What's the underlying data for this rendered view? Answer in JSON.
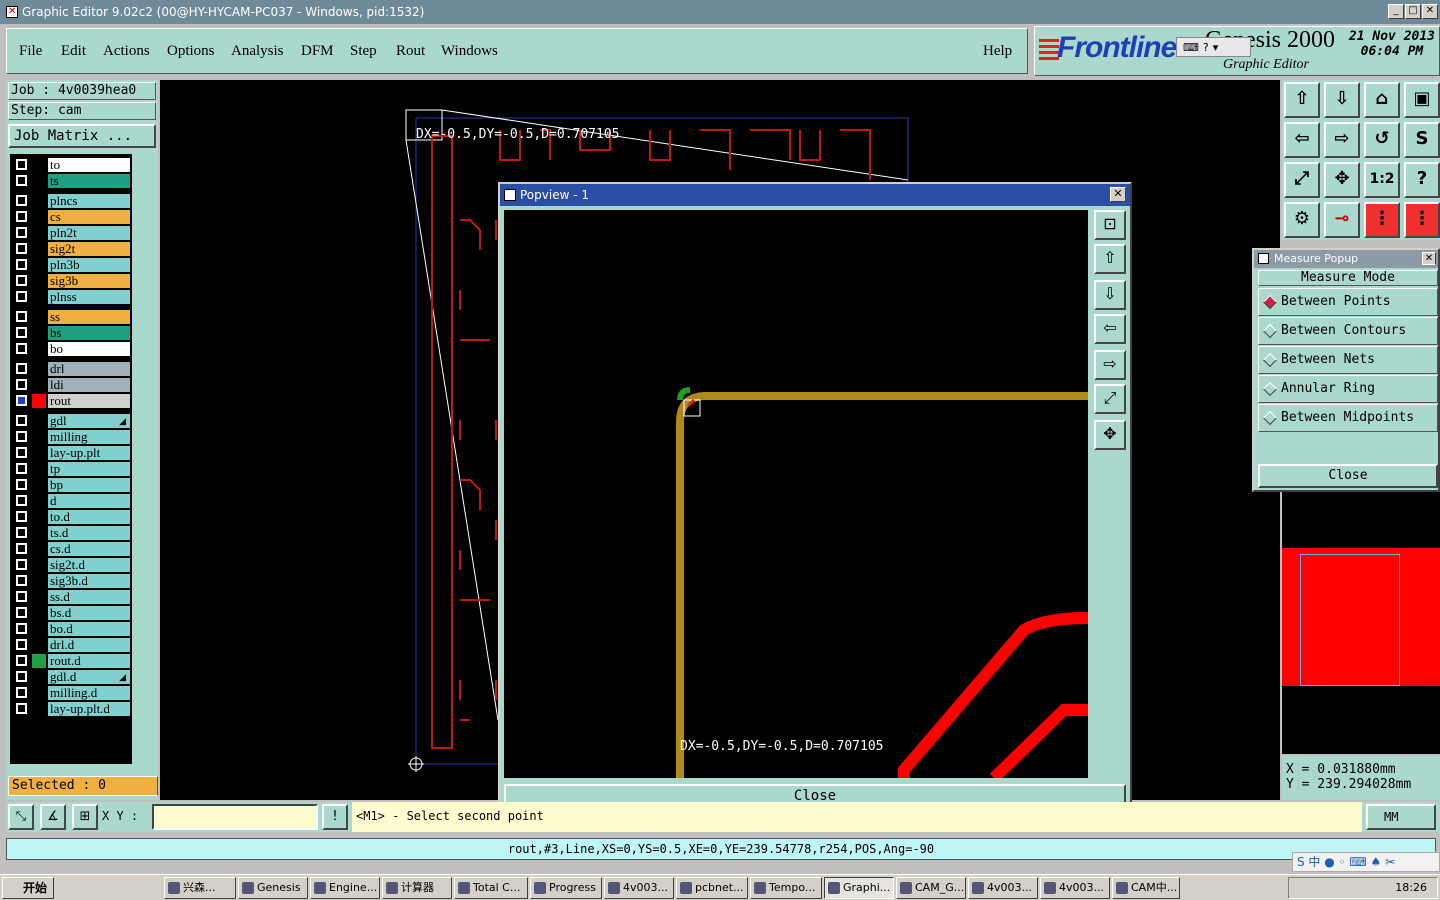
{
  "window": {
    "title": "Graphic Editor 9.02c2 (00@HY-HYCAM-PC037 - Windows, pid:1532)",
    "min": "_",
    "max": "□",
    "close": "✕"
  },
  "menu": {
    "items": [
      "File",
      "Edit",
      "Actions",
      "Options",
      "Analysis",
      "DFM",
      "Step",
      "Rout",
      "Windows"
    ],
    "help": "Help"
  },
  "logo": {
    "brand": "Frontline",
    "product": "Genesis 2000",
    "subtitle": "Graphic Editor",
    "date": "21 Nov 2013",
    "time": "06:04 PM"
  },
  "job": {
    "job_label": "Job : 4v0039hea0",
    "step_label": "Step: cam",
    "matrix_button": "Job Matrix ..."
  },
  "layers": [
    {
      "name": "to",
      "color": "#ffffff"
    },
    {
      "name": "ts",
      "color": "#20a080"
    },
    {
      "name": "plncs",
      "color": "#80d0d0"
    },
    {
      "name": "cs",
      "color": "#f0b040"
    },
    {
      "name": "pln2t",
      "color": "#80d0d0"
    },
    {
      "name": "sig2t",
      "color": "#f0b040"
    },
    {
      "name": "pln3b",
      "color": "#80d0d0"
    },
    {
      "name": "sig3b",
      "color": "#f0b040"
    },
    {
      "name": "plnss",
      "color": "#80d0d0"
    },
    {
      "name": "ss",
      "color": "#f0b040"
    },
    {
      "name": "bs",
      "color": "#20a080"
    },
    {
      "name": "bo",
      "color": "#ffffff"
    },
    {
      "name": "drl",
      "color": "#a0b0b8"
    },
    {
      "name": "ldi",
      "color": "#a0b0b8"
    },
    {
      "name": "rout",
      "color": "#d0d0d0",
      "active": true
    },
    {
      "name": "gdl",
      "color": "#80d0d0",
      "mark": "◢"
    },
    {
      "name": "milling",
      "color": "#80d0d0"
    },
    {
      "name": "lay-up.plt",
      "color": "#80d0d0"
    },
    {
      "name": "tp",
      "color": "#80d0d0"
    },
    {
      "name": "bp",
      "color": "#80d0d0"
    },
    {
      "name": "d",
      "color": "#80d0d0"
    },
    {
      "name": "to.d",
      "color": "#80d0d0"
    },
    {
      "name": "ts.d",
      "color": "#80d0d0"
    },
    {
      "name": "cs.d",
      "color": "#80d0d0"
    },
    {
      "name": "sig2t.d",
      "color": "#80d0d0"
    },
    {
      "name": "sig3b.d",
      "color": "#80d0d0"
    },
    {
      "name": "ss.d",
      "color": "#80d0d0"
    },
    {
      "name": "bs.d",
      "color": "#80d0d0"
    },
    {
      "name": "bo.d",
      "color": "#80d0d0"
    },
    {
      "name": "drl.d",
      "color": "#80d0d0"
    },
    {
      "name": "rout.d",
      "color": "#80d0d0",
      "swatch": "#20a040"
    },
    {
      "name": "gdl.d",
      "color": "#80d0d0",
      "mark": "◢"
    },
    {
      "name": "milling.d",
      "color": "#80d0d0"
    },
    {
      "name": "lay-up.plt.d",
      "color": "#80d0d0"
    }
  ],
  "selected": "Selected : 0",
  "canvas": {
    "measure_text": "DX=-0.5,DY=-0.5,D=0.707105"
  },
  "popview": {
    "title": "Popview - 1",
    "measure_text": "DX=-0.5,DY=-0.5,D=0.707105",
    "close_button": "Close"
  },
  "measure_popup": {
    "title": "Measure Popup",
    "heading": "Measure Mode",
    "options": [
      "Between Points",
      "Between Contours",
      "Between Nets",
      "Annular Ring",
      "Between Midpoints"
    ],
    "selected_index": 0,
    "close_button": "Close"
  },
  "coords": {
    "x": "X = 0.031880mm",
    "y": "Y = 239.294028mm"
  },
  "command": {
    "xy_label": "X Y :",
    "xy_value": "",
    "prompt": "<M1> - Select second point",
    "units": "MM"
  },
  "status_line": "rout,#3,Line,XS=0,YS=0.5,XE=0,YE=239.54778,r254,POS,Ang=-90",
  "taskbar": {
    "start": "开始",
    "tasks": [
      "兴森...",
      "Genesis",
      "Engine...",
      "计算器",
      "Total C...",
      "Progress",
      "4v003...",
      "pcbnet...",
      "Tempo...",
      "Graphi...",
      "CAM_G...",
      "4v003...",
      "4v003...",
      "CAM中..."
    ],
    "active_index": 9,
    "clock": "18:26"
  },
  "ime": "S 中 ● ◦ ⌨ ♠ ✂"
}
